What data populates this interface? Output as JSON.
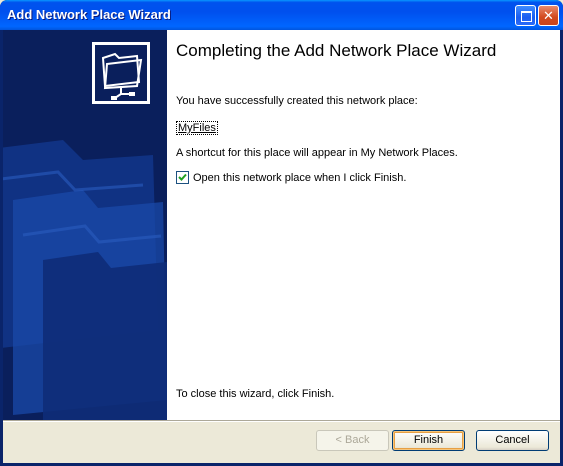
{
  "window": {
    "title": "Add Network Place Wizard"
  },
  "wizard": {
    "heading": "Completing the Add Network Place Wizard",
    "success_text": "You have successfully created this network place:",
    "place_name": "MyFiles",
    "shortcut_text": "A shortcut for this place will appear in My Network Places.",
    "open_checkbox": {
      "label": "Open this network place when I click Finish.",
      "checked": true
    },
    "close_text": "To close this wizard, click Finish."
  },
  "buttons": {
    "back": "< Back",
    "finish": "Finish",
    "cancel": "Cancel"
  },
  "icons": {
    "titlebar_restore": "restore-icon",
    "titlebar_close": "close-icon",
    "wizard_graphic": "network-folder-icon",
    "checkmark": "checkmark-icon"
  },
  "colors": {
    "titlebar": "#0055ee",
    "left_panel": "#0a1f5c",
    "close_button": "#d24a1e"
  }
}
